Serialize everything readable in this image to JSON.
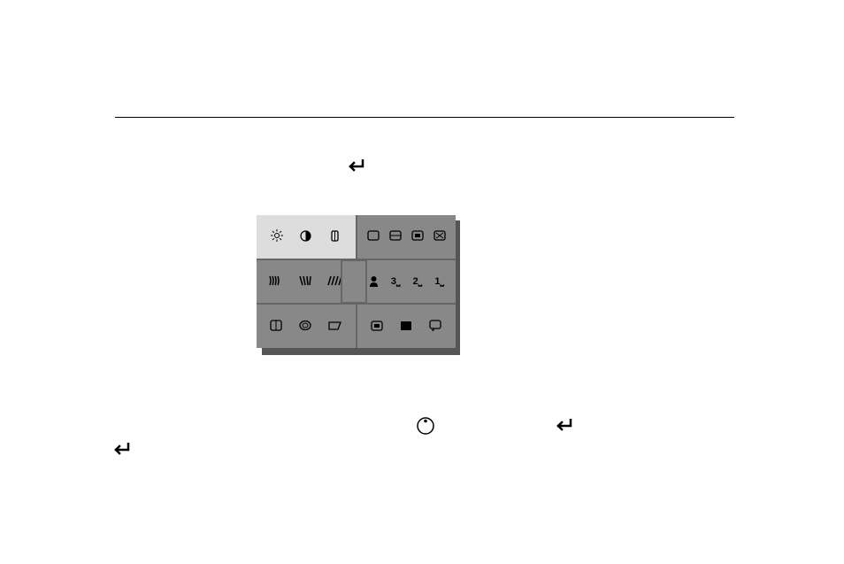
{
  "divider": true,
  "osd": {
    "rows": [
      {
        "left": {
          "selected": true,
          "icons": [
            "brightness-icon",
            "contrast-icon",
            "hposition-icon"
          ]
        },
        "right": {
          "selected": false,
          "icons": [
            "hsize-icon",
            "vposition-icon",
            "vsize-icon",
            "zoom-icon"
          ]
        }
      },
      {
        "left": {
          "selected": false,
          "icons": [
            "pincushion-icon",
            "trapezoid-icon",
            "parallel-icon"
          ]
        },
        "right": {
          "selected": false,
          "icons": [
            "user-icon",
            "preset3-icon",
            "preset2-icon",
            "preset1-icon"
          ]
        }
      },
      {
        "left": {
          "selected": false,
          "icons": [
            "rotation-icon",
            "moire-icon",
            "degauss-icon"
          ]
        },
        "right": {
          "selected": false,
          "icons": [
            "osd-move-icon",
            "language-icon",
            "info-icon"
          ]
        }
      }
    ]
  },
  "icons": {
    "enter": "↵",
    "dial": "⊚"
  }
}
